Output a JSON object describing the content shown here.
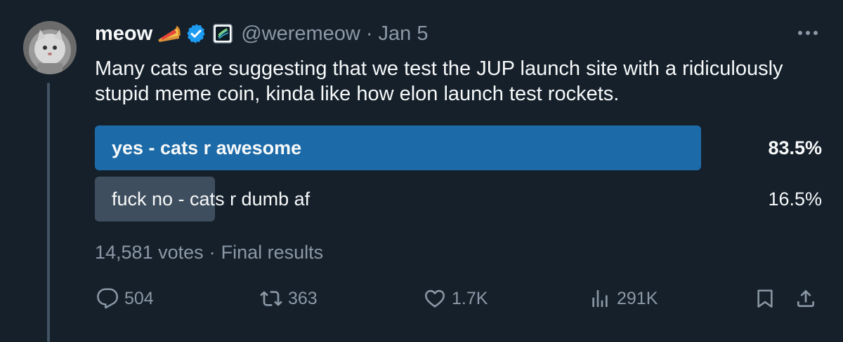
{
  "tweet": {
    "author_name": "meow",
    "handle": "@weremeow",
    "separator": "·",
    "date": "Jan 5",
    "text": "Many cats are suggesting that we test the JUP launch site with a ridiculously stupid meme coin, kinda like how elon launch test rockets."
  },
  "poll": {
    "options": [
      {
        "label": "yes - cats r awesome",
        "percent": "83.5%",
        "fraction": 0.835,
        "bar_color": "#1d6aa8"
      },
      {
        "label": "fuck no - cats r dumb af",
        "percent": "16.5%",
        "fraction": 0.165,
        "bar_color": "#3f4e5e"
      }
    ],
    "votes": "14,581 votes",
    "separator": "·",
    "status": "Final results"
  },
  "actions": {
    "replies": "504",
    "retweets": "363",
    "likes": "1.7K",
    "views": "291K"
  },
  "colors": {
    "background": "#15202b",
    "text": "#f7f9f9",
    "secondary": "#8b98a5",
    "verified": "#1d9bf0"
  },
  "icons": [
    "pie-emoji-icon",
    "verified-badge-icon",
    "affiliate-badge-icon",
    "more-icon",
    "reply-icon",
    "retweet-icon",
    "like-icon",
    "views-icon",
    "bookmark-icon",
    "share-icon"
  ]
}
